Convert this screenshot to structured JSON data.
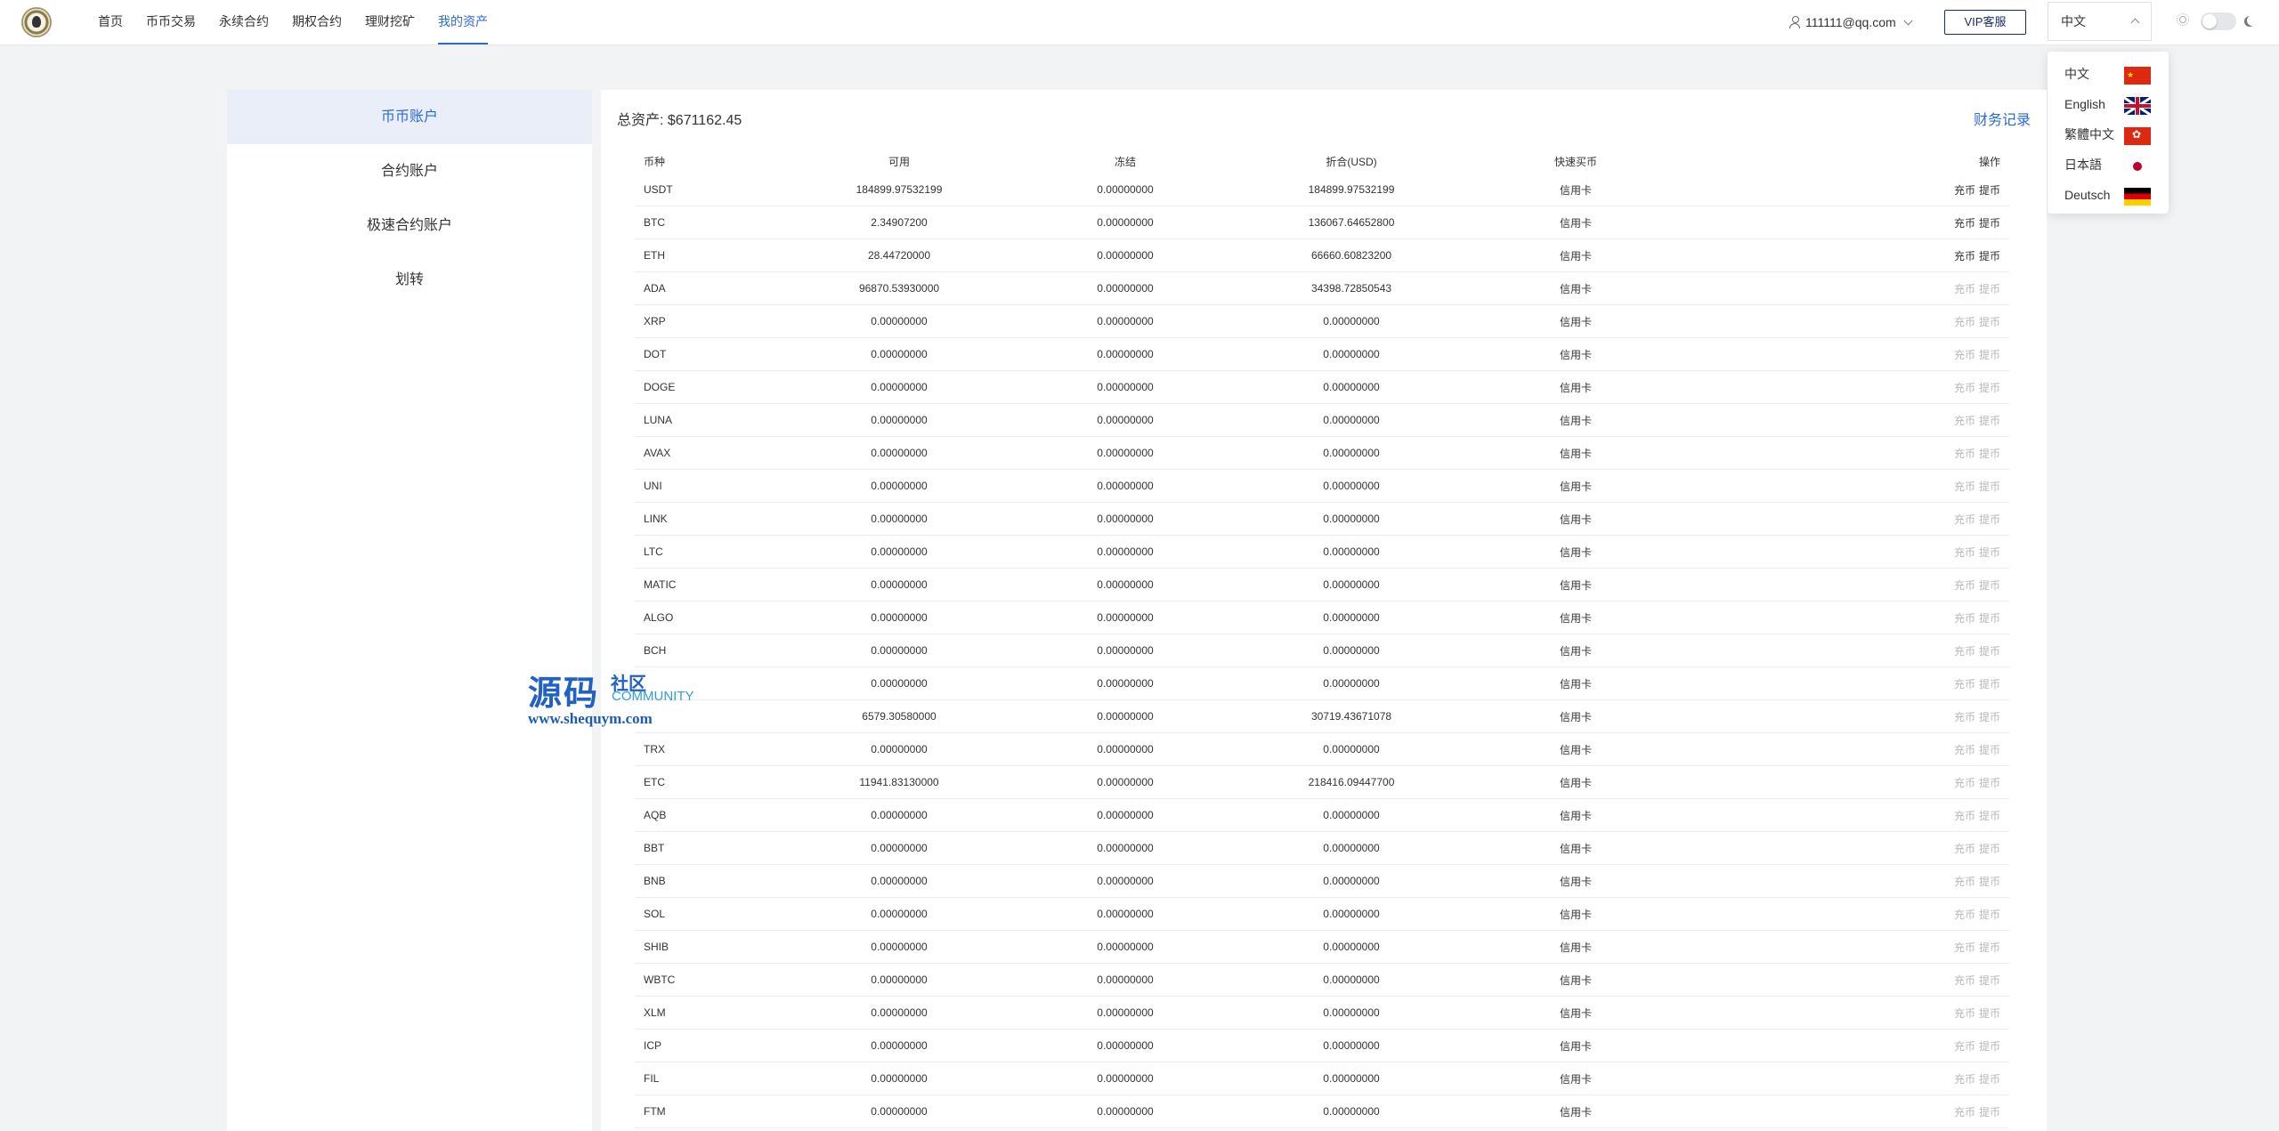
{
  "nav": {
    "items": [
      "首页",
      "币币交易",
      "永续合约",
      "期权合约",
      "理财挖矿",
      "我的资产"
    ],
    "active_index": 5
  },
  "user": {
    "email": "111111@qq.com"
  },
  "vip_button": "VIP客服",
  "language": {
    "selected": "中文",
    "options": [
      {
        "label": "中文",
        "flag": "cn-flag-icon"
      },
      {
        "label": "English",
        "flag": "gb-flag-icon"
      },
      {
        "label": "繁體中文",
        "flag": "hk-flag-icon"
      },
      {
        "label": "日本語",
        "flag": "jp-flag-icon"
      },
      {
        "label": "Deutsch",
        "flag": "de-flag-icon"
      }
    ]
  },
  "sidebar": {
    "items": [
      "币币账户",
      "合约账户",
      "极速合约账户",
      "划转"
    ],
    "active_index": 0
  },
  "account": {
    "total_label": "总资产: $671162.45",
    "records_link": "财务记录"
  },
  "table": {
    "headers": [
      "币种",
      "可用",
      "冻结",
      "折合(USD)",
      "快速买币",
      "操作"
    ],
    "buy_label": "信用卡",
    "deposit_label": "充币",
    "withdraw_label": "提币",
    "rows": [
      {
        "coin": "USDT",
        "available": "184899.97532199",
        "frozen": "0.00000000",
        "usd": "184899.97532199",
        "enabled": true
      },
      {
        "coin": "BTC",
        "available": "2.34907200",
        "frozen": "0.00000000",
        "usd": "136067.64652800",
        "enabled": true
      },
      {
        "coin": "ETH",
        "available": "28.44720000",
        "frozen": "0.00000000",
        "usd": "66660.60823200",
        "enabled": true
      },
      {
        "coin": "ADA",
        "available": "96870.53930000",
        "frozen": "0.00000000",
        "usd": "34398.72850543",
        "enabled": false
      },
      {
        "coin": "XRP",
        "available": "0.00000000",
        "frozen": "0.00000000",
        "usd": "0.00000000",
        "enabled": false
      },
      {
        "coin": "DOT",
        "available": "0.00000000",
        "frozen": "0.00000000",
        "usd": "0.00000000",
        "enabled": false
      },
      {
        "coin": "DOGE",
        "available": "0.00000000",
        "frozen": "0.00000000",
        "usd": "0.00000000",
        "enabled": false
      },
      {
        "coin": "LUNA",
        "available": "0.00000000",
        "frozen": "0.00000000",
        "usd": "0.00000000",
        "enabled": false
      },
      {
        "coin": "AVAX",
        "available": "0.00000000",
        "frozen": "0.00000000",
        "usd": "0.00000000",
        "enabled": false
      },
      {
        "coin": "UNI",
        "available": "0.00000000",
        "frozen": "0.00000000",
        "usd": "0.00000000",
        "enabled": false
      },
      {
        "coin": "LINK",
        "available": "0.00000000",
        "frozen": "0.00000000",
        "usd": "0.00000000",
        "enabled": false
      },
      {
        "coin": "LTC",
        "available": "0.00000000",
        "frozen": "0.00000000",
        "usd": "0.00000000",
        "enabled": false
      },
      {
        "coin": "MATIC",
        "available": "0.00000000",
        "frozen": "0.00000000",
        "usd": "0.00000000",
        "enabled": false
      },
      {
        "coin": "ALGO",
        "available": "0.00000000",
        "frozen": "0.00000000",
        "usd": "0.00000000",
        "enabled": false
      },
      {
        "coin": "BCH",
        "available": "0.00000000",
        "frozen": "0.00000000",
        "usd": "0.00000000",
        "enabled": false
      },
      {
        "coin": "",
        "available": "0.00000000",
        "frozen": "0.00000000",
        "usd": "0.00000000",
        "enabled": false
      },
      {
        "coin": "",
        "available": "6579.30580000",
        "frozen": "0.00000000",
        "usd": "30719.43671078",
        "enabled": false
      },
      {
        "coin": "TRX",
        "available": "0.00000000",
        "frozen": "0.00000000",
        "usd": "0.00000000",
        "enabled": false
      },
      {
        "coin": "ETC",
        "available": "11941.83130000",
        "frozen": "0.00000000",
        "usd": "218416.09447700",
        "enabled": false
      },
      {
        "coin": "AQB",
        "available": "0.00000000",
        "frozen": "0.00000000",
        "usd": "0.00000000",
        "enabled": false
      },
      {
        "coin": "BBT",
        "available": "0.00000000",
        "frozen": "0.00000000",
        "usd": "0.00000000",
        "enabled": false
      },
      {
        "coin": "BNB",
        "available": "0.00000000",
        "frozen": "0.00000000",
        "usd": "0.00000000",
        "enabled": false
      },
      {
        "coin": "SOL",
        "available": "0.00000000",
        "frozen": "0.00000000",
        "usd": "0.00000000",
        "enabled": false
      },
      {
        "coin": "SHIB",
        "available": "0.00000000",
        "frozen": "0.00000000",
        "usd": "0.00000000",
        "enabled": false
      },
      {
        "coin": "WBTC",
        "available": "0.00000000",
        "frozen": "0.00000000",
        "usd": "0.00000000",
        "enabled": false
      },
      {
        "coin": "XLM",
        "available": "0.00000000",
        "frozen": "0.00000000",
        "usd": "0.00000000",
        "enabled": false
      },
      {
        "coin": "ICP",
        "available": "0.00000000",
        "frozen": "0.00000000",
        "usd": "0.00000000",
        "enabled": false
      },
      {
        "coin": "FIL",
        "available": "0.00000000",
        "frozen": "0.00000000",
        "usd": "0.00000000",
        "enabled": false
      },
      {
        "coin": "FTM",
        "available": "0.00000000",
        "frozen": "0.00000000",
        "usd": "0.00000000",
        "enabled": false
      }
    ]
  },
  "watermark": {
    "cn": "源码",
    "cn2": "社区",
    "en": "COMMUNITY",
    "url": "www.shequym.com"
  },
  "colors": {
    "accent": "#2b6ad6",
    "vip_border": "#1a2b6b",
    "page_bg": "#f2f3f5",
    "disabled_text": "#b7b7b7"
  }
}
